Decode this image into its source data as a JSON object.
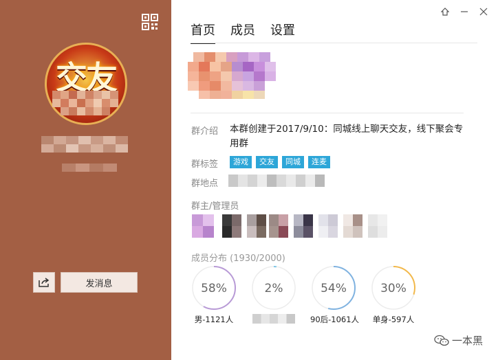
{
  "sidebar": {
    "avatar_text": "交友",
    "send_message_label": "发消息"
  },
  "tabs": [
    {
      "label": "首页",
      "active": true
    },
    {
      "label": "成员",
      "active": false
    },
    {
      "label": "设置",
      "active": false
    }
  ],
  "info": {
    "intro_label": "群介绍",
    "intro_text": "本群创建于2017/9/10：同城线上聊天交友，线下聚会专用群",
    "tags_label": "群标签",
    "tags": [
      "游戏",
      "交友",
      "同城",
      "连麦"
    ],
    "location_label": "群地点",
    "admins_label": "群主/管理员"
  },
  "distribution": {
    "label": "成员分布 (1930/2000)",
    "items": [
      {
        "percent": 58,
        "text": "58%",
        "caption": "男-1121人",
        "color": "#b89ad6"
      },
      {
        "percent": 2,
        "text": "2%",
        "caption": "",
        "color": "#7ec6e6"
      },
      {
        "percent": 54,
        "text": "54%",
        "caption": "90后-1061人",
        "color": "#7fb2e0"
      },
      {
        "percent": 30,
        "text": "30%",
        "caption": "单身-597人",
        "color": "#f2b84a"
      }
    ]
  },
  "watermark": {
    "text": "一本黑"
  }
}
